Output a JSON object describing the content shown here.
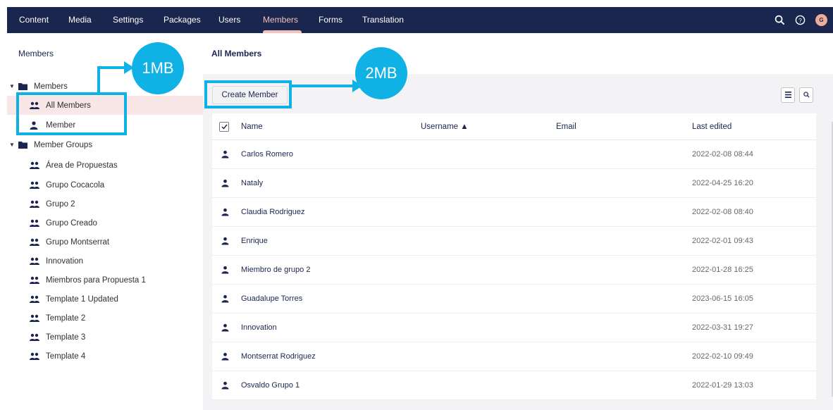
{
  "topnav": {
    "items": [
      "Content",
      "Media",
      "Settings",
      "Packages",
      "Users",
      "Members",
      "Forms",
      "Translation"
    ],
    "active": "Members",
    "avatar_initial": "G"
  },
  "sidebar": {
    "title": "Members",
    "items": [
      {
        "label": "Members",
        "type": "folder"
      },
      {
        "label": "All Members",
        "type": "group"
      },
      {
        "label": "Member",
        "type": "user"
      },
      {
        "label": "Member Groups",
        "type": "folder"
      },
      {
        "label": "Área de Propuestas",
        "type": "group"
      },
      {
        "label": "Grupo Cocacola",
        "type": "group"
      },
      {
        "label": "Grupo 2",
        "type": "group"
      },
      {
        "label": "Grupo Creado",
        "type": "group"
      },
      {
        "label": "Grupo Montserrat",
        "type": "group"
      },
      {
        "label": "Innovation",
        "type": "group"
      },
      {
        "label": "Miembros para Propuesta 1",
        "type": "group"
      },
      {
        "label": "Template 1 Updated",
        "type": "group"
      },
      {
        "label": "Template 2",
        "type": "group"
      },
      {
        "label": "Template 3",
        "type": "group"
      },
      {
        "label": "Template 4",
        "type": "group"
      }
    ]
  },
  "main": {
    "title": "All Members",
    "create_button": "Create Member",
    "columns": {
      "name": "Name",
      "username": "Username ▲",
      "email": "Email",
      "last_edited": "Last edited"
    },
    "rows": [
      {
        "name": "Carlos Romero",
        "last_edited": "2022-02-08 08:44"
      },
      {
        "name": "Nataly",
        "last_edited": "2022-04-25 16:20"
      },
      {
        "name": "Claudia Rodriguez",
        "last_edited": "2022-02-08 08:40"
      },
      {
        "name": "Enrique",
        "last_edited": "2022-02-01 09:43"
      },
      {
        "name": "Miembro de grupo 2",
        "last_edited": "2022-01-28 16:25"
      },
      {
        "name": "Guadalupe Torres",
        "last_edited": "2023-06-15 16:05"
      },
      {
        "name": "Innovation",
        "last_edited": "2022-03-31 19:27"
      },
      {
        "name": "Montserrat Rodriguez",
        "last_edited": "2022-02-10 09:49"
      },
      {
        "name": "Osvaldo Grupo 1",
        "last_edited": "2022-01-29 13:03"
      }
    ]
  },
  "callouts": {
    "first": "1MB",
    "second": "2MB",
    "color": "#10b1e4"
  },
  "colors": {
    "topbar": "#1b264f",
    "active_nav": "#f5c1bc",
    "selected_row": "#f8e7e6"
  }
}
